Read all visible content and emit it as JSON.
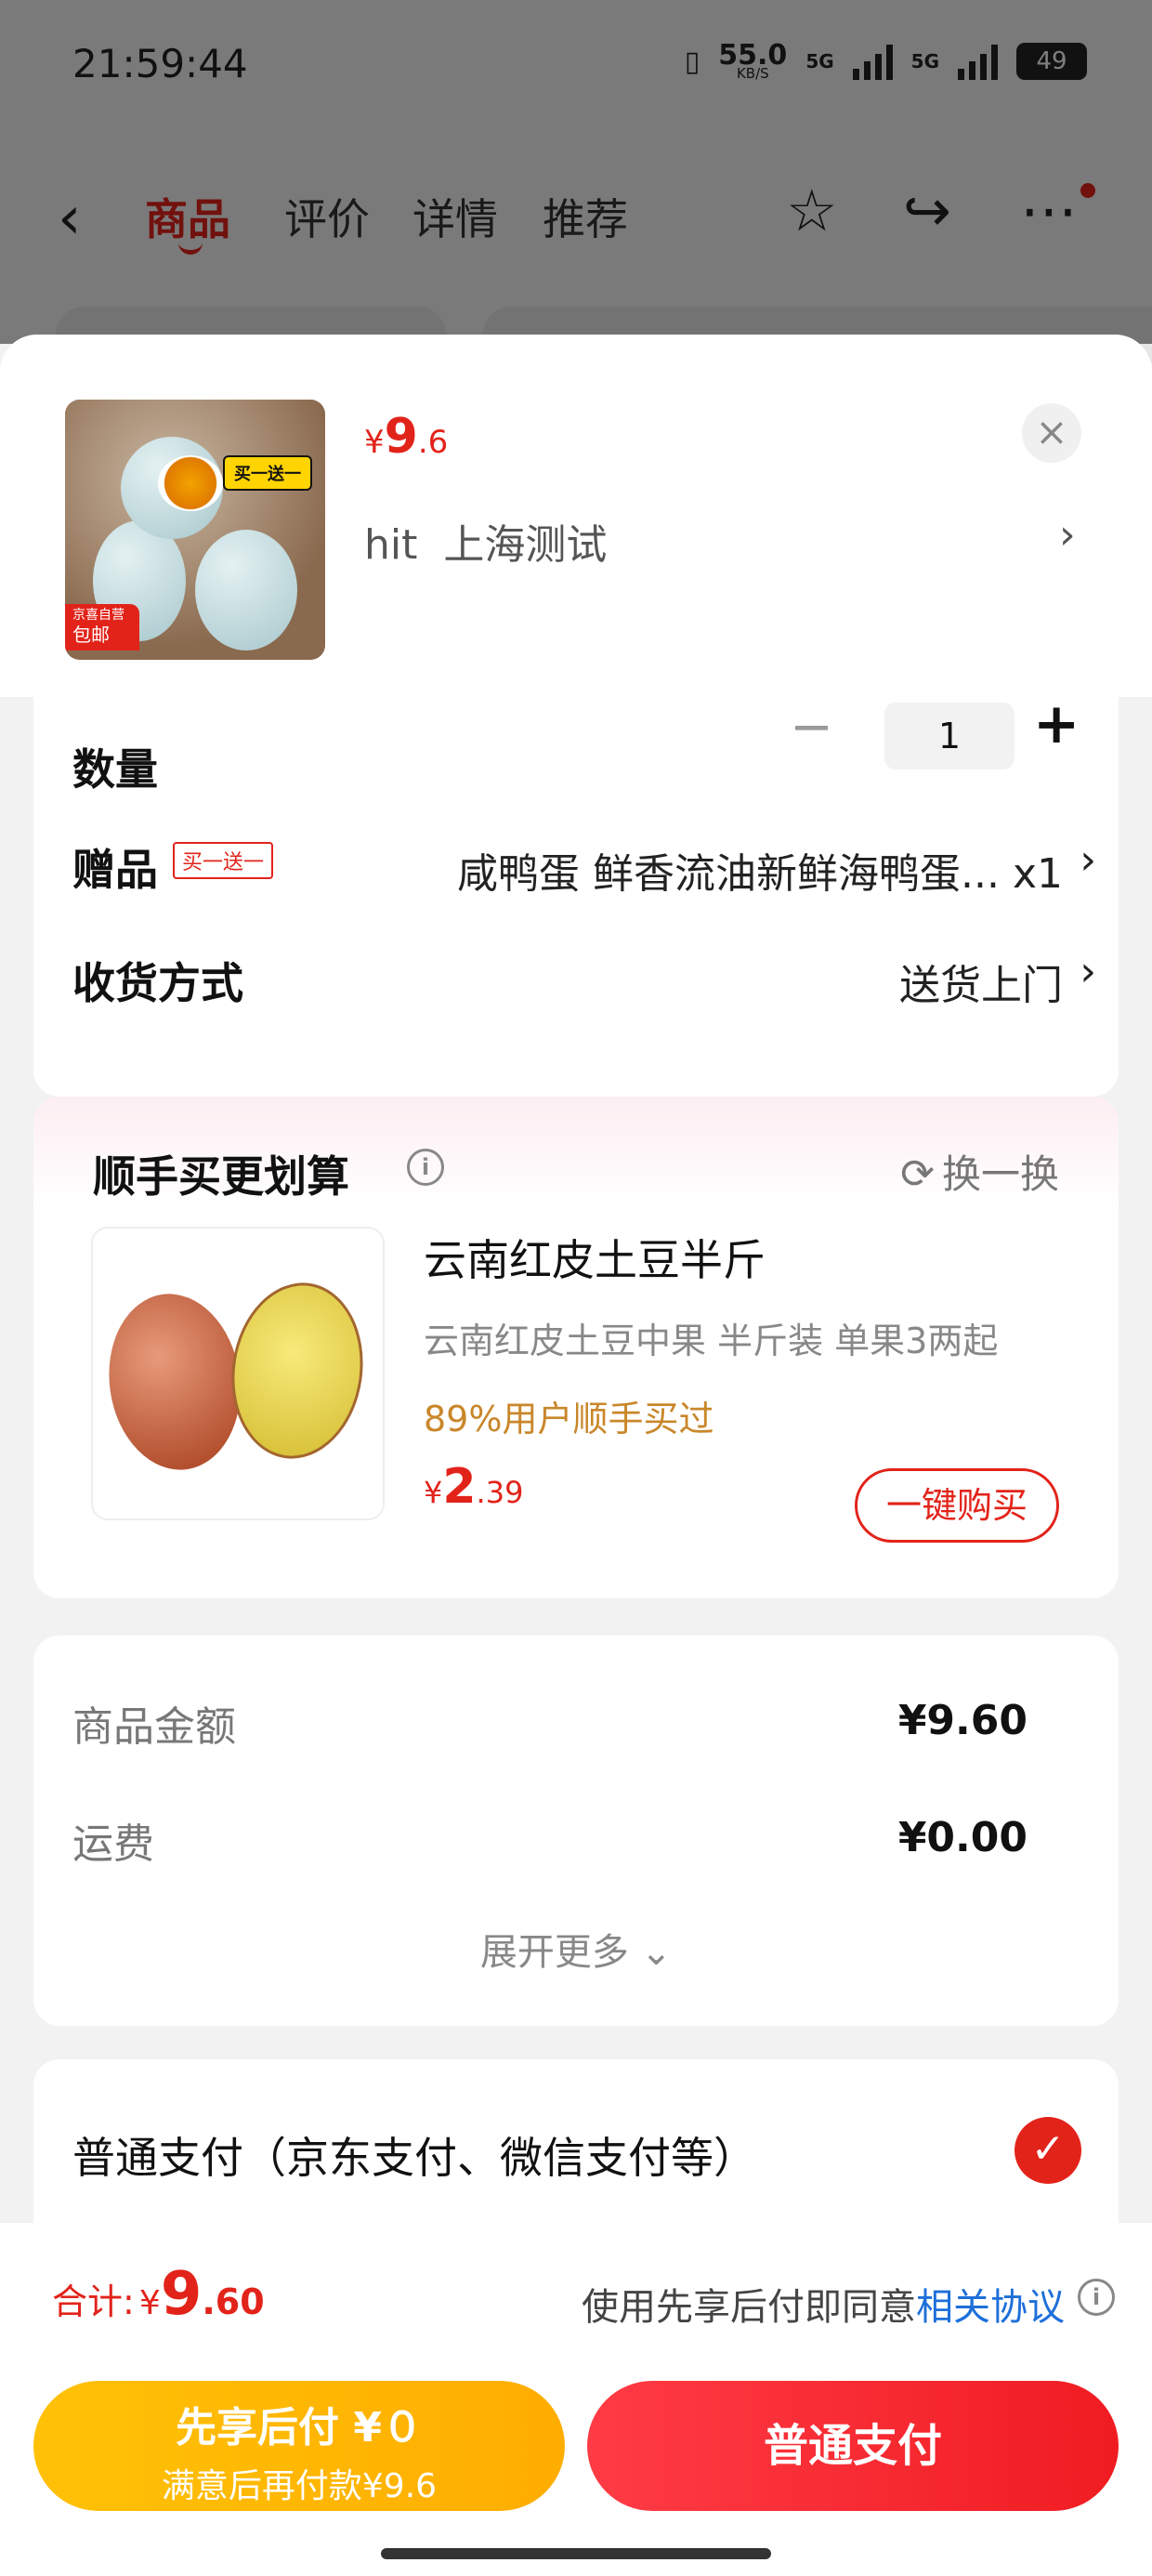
{
  "status_bar": {
    "time": "21:59:44",
    "net_speed": "55.0",
    "net_unit": "KB/S",
    "sig1": "5G",
    "sig2": "5G",
    "battery": "49"
  },
  "nav": {
    "tabs": [
      {
        "label": "商品",
        "active": true
      },
      {
        "label": "评价"
      },
      {
        "label": "详情"
      },
      {
        "label": "推荐"
      }
    ],
    "icons": [
      "back-icon",
      "star-icon",
      "share-icon",
      "more-icon"
    ]
  },
  "product": {
    "price_currency": "¥",
    "price_int": "9",
    "price_dec": ".6",
    "address_name": "hit",
    "address_city": "上海测试",
    "badge_promo": "买一送一",
    "badge_self": "京喜自营",
    "badge_ship": "包邮"
  },
  "options": {
    "qty_label": "数量",
    "qty_value": "1",
    "gift_label": "赠品",
    "gift_tag": "买一送一",
    "gift_value": "咸鸭蛋 鲜香流油新鲜海鸭蛋... x1",
    "delivery_label": "收货方式",
    "delivery_value": "送货上门"
  },
  "bundle": {
    "title": "顺手买更划算",
    "swap_label": "换一换",
    "item_title": "云南红皮土豆半斤",
    "item_sub": "云南红皮土豆中果 半斤装 单果3两起",
    "item_note": "89%用户顺手买过",
    "price_currency": "¥",
    "price_int": "2",
    "price_dec": ".39",
    "buy_label": "一键购买"
  },
  "summary": {
    "goods_label": "商品金额",
    "goods_value": "¥9.60",
    "ship_label": "运费",
    "ship_value": "¥0.00",
    "more_label": "展开更多"
  },
  "payment": {
    "normal_label": "普通支付（京东支付、微信支付等）"
  },
  "footer": {
    "total_label": "合计:",
    "total_currency": "¥",
    "total_int": "9",
    "total_dec": ".60",
    "agree_prefix": "使用先享后付即同意",
    "agree_link": "相关协议",
    "later_line1": "先享后付 ¥０",
    "later_line2": "满意后再付款¥9.6",
    "normal_pay_label": "普通支付"
  },
  "colors": {
    "accent": "#e2231a",
    "pay_later": "#ffb300",
    "link": "#1e6fd9"
  }
}
